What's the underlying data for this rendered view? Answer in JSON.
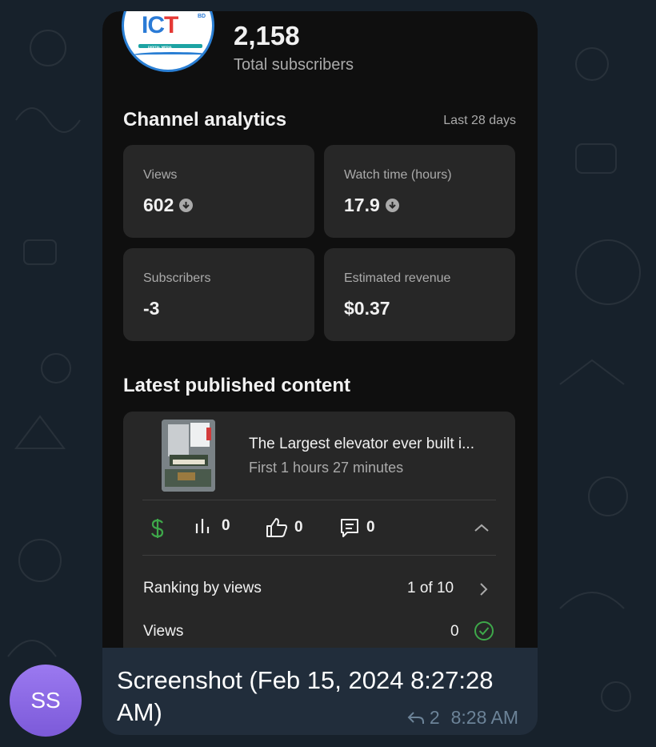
{
  "channel": {
    "subscriber_count": "2,158",
    "subscriber_label": "Total subscribers",
    "logo_text_a": "IC",
    "logo_text_b": "T",
    "logo_small": "BD",
    "logo_caption": "DIGITAL MEDIA"
  },
  "analytics": {
    "title": "Channel analytics",
    "range": "Last 28 days",
    "cards": [
      {
        "label": "Views",
        "value": "602",
        "icon": "arrow-down-circle-icon"
      },
      {
        "label": "Watch time (hours)",
        "value": "17.9",
        "icon": "arrow-down-circle-icon"
      },
      {
        "label": "Subscribers",
        "value": "-3"
      },
      {
        "label": "Estimated revenue",
        "value": "$0.37"
      }
    ]
  },
  "latest": {
    "title": "Latest published content",
    "video_title": "The Largest elevator ever built i...",
    "video_subtitle": "First 1 hours 27 minutes",
    "stats": {
      "views": "0",
      "likes": "0",
      "comments": "0"
    },
    "rows": [
      {
        "label": "Ranking by views",
        "value": "1 of 10"
      },
      {
        "label": "Views",
        "value": "0"
      }
    ]
  },
  "message": {
    "caption": "Screenshot (Feb 15, 2024 8:27:28 AM)",
    "reply_count": "2",
    "time": "8:28 AM",
    "sender_initials": "SS"
  },
  "colors": {
    "chat_bg": "#17212b",
    "bubble_bg": "#212d3b",
    "app_bg": "#0f0f0f",
    "card_bg": "#272727",
    "revenue_green": "#3ea84a",
    "avatar_purple": "#8b6ae6",
    "meta_text": "#6c8398"
  }
}
